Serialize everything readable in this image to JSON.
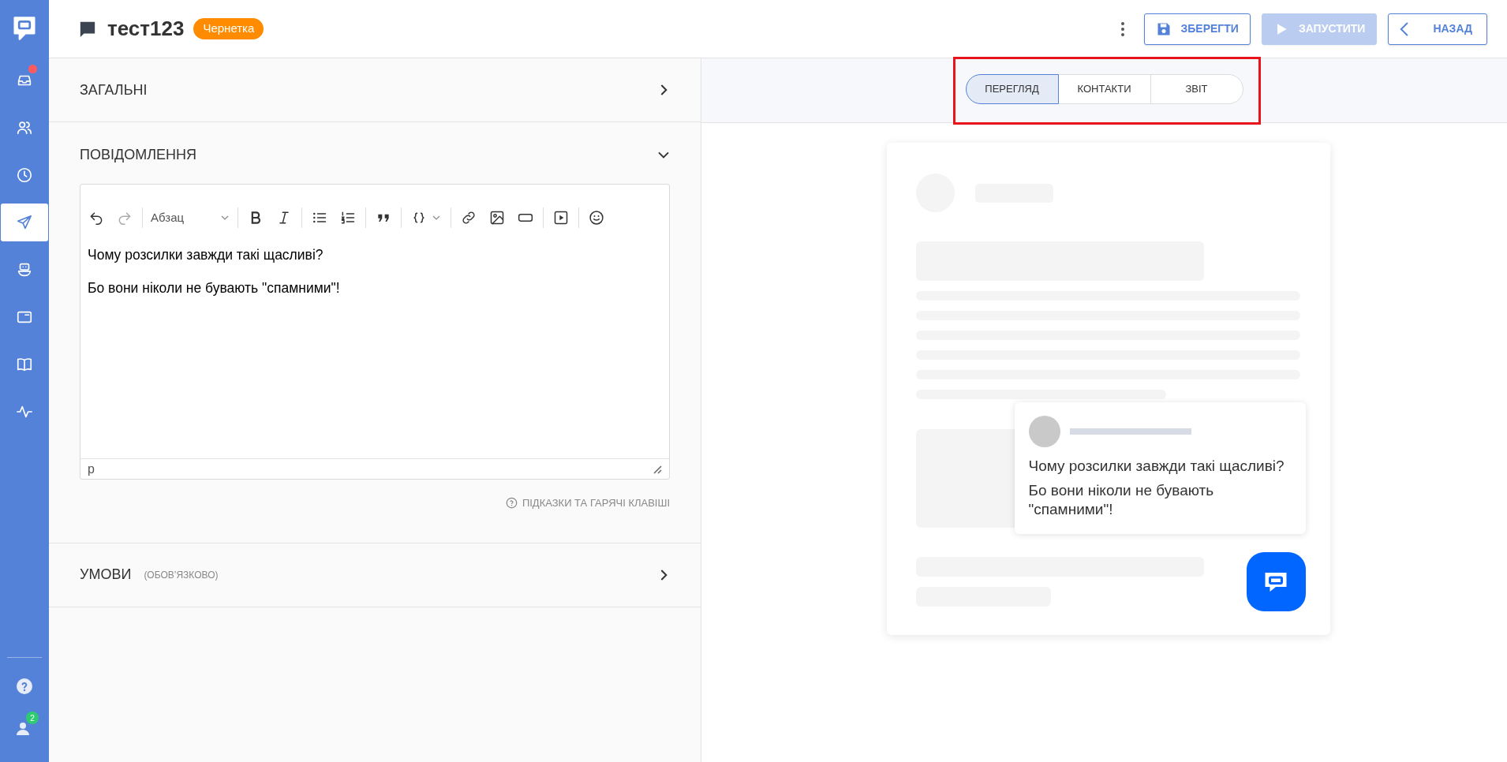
{
  "sidebar": {
    "items": [
      {
        "selected": false,
        "alert": true
      },
      {
        "selected": false,
        "alert": false
      },
      {
        "selected": false,
        "alert": false
      },
      {
        "selected": true,
        "alert": false
      },
      {
        "selected": false,
        "alert": false
      },
      {
        "selected": false,
        "alert": false
      },
      {
        "selected": false,
        "alert": false
      },
      {
        "selected": false,
        "alert": false
      }
    ],
    "bottom_items": [
      {
        "kind": "help"
      },
      {
        "kind": "agents",
        "badge": "2"
      }
    ]
  },
  "header": {
    "title": "тест123",
    "status": "Чернетка",
    "buttons": [
      {
        "kind": "save",
        "label": "ЗБЕРЕГТИ",
        "disabled": false
      },
      {
        "kind": "run",
        "label": "ЗАПУСТИТИ",
        "disabled": true
      },
      {
        "kind": "back",
        "label": "НАЗАД",
        "disabled": false
      }
    ]
  },
  "sections": [
    {
      "kind": "collapsed",
      "title": "ЗАГАЛЬНІ",
      "expanded": false
    },
    {
      "kind": "editor",
      "title": "ПОВІДОМЛЕННЯ",
      "expanded": true,
      "toolbar": [
        [
          {
            "kind": "button",
            "disabled": false
          },
          {
            "kind": "button",
            "disabled": true
          }
        ],
        [
          {
            "kind": "dropdown",
            "label": "Абзац"
          }
        ],
        [
          {
            "kind": "button",
            "disabled": false
          },
          {
            "kind": "button",
            "disabled": false
          }
        ],
        [
          {
            "kind": "button",
            "disabled": false
          },
          {
            "kind": "button",
            "disabled": false
          }
        ],
        [
          {
            "kind": "button",
            "disabled": false
          }
        ],
        [
          {
            "kind": "button",
            "disabled": false
          }
        ],
        [
          {
            "kind": "button",
            "disabled": false
          },
          {
            "kind": "button",
            "disabled": false
          },
          {
            "kind": "button",
            "disabled": false
          }
        ],
        [
          {
            "kind": "button",
            "disabled": false
          }
        ],
        [
          {
            "kind": "button",
            "disabled": false
          }
        ]
      ],
      "paragraphs": [
        "Чому розсилки завжди такі щасливі?",
        "Бо вони ніколи не бувають \"спамними\"!"
      ],
      "path": "p",
      "hint": "ПІДКАЗКИ ТА ГАРЯЧІ КЛАВІШІ"
    },
    {
      "kind": "collapsed",
      "title": "УМОВИ",
      "note": "(ОБОВ’ЯЗКОВО)",
      "expanded": false
    }
  ],
  "tabs": [
    {
      "label": "ПЕРЕГЛЯД",
      "selected": true
    },
    {
      "label": "КОНТАКТИ",
      "selected": false
    },
    {
      "label": "ЗВІТ",
      "selected": false
    }
  ],
  "preview": {
    "message": [
      "Чому розсилки завжди такі щасливі?",
      "Бо вони ніколи не бувають \"спамними\"!"
    ]
  }
}
